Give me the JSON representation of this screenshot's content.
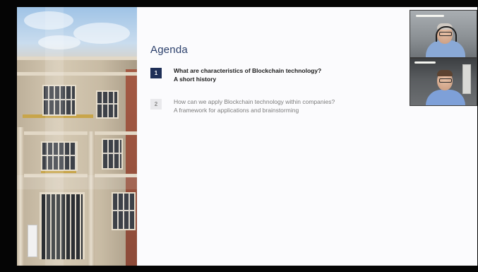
{
  "slide": {
    "title": "Agenda",
    "items": [
      {
        "number": "1",
        "line1": "What are characteristics of Blockchain technology?",
        "line2": "A short history",
        "state": "active"
      },
      {
        "number": "2",
        "line1": "How can we apply Blockchain technology within companies?",
        "line2": "A framework for applications and brainstorming",
        "state": "inactive"
      }
    ],
    "photo_subject": "historic building facade"
  },
  "video_tiles": [
    {
      "participant": "participant-1",
      "shirt_color": "#8aa9d6"
    },
    {
      "participant": "participant-2",
      "shirt_color": "#7ea0d8"
    }
  ],
  "colors": {
    "accent": "#1e2f57",
    "title": "#2a3f6b",
    "slide_bg": "#fbfbfd",
    "frame_bg": "#050505"
  }
}
